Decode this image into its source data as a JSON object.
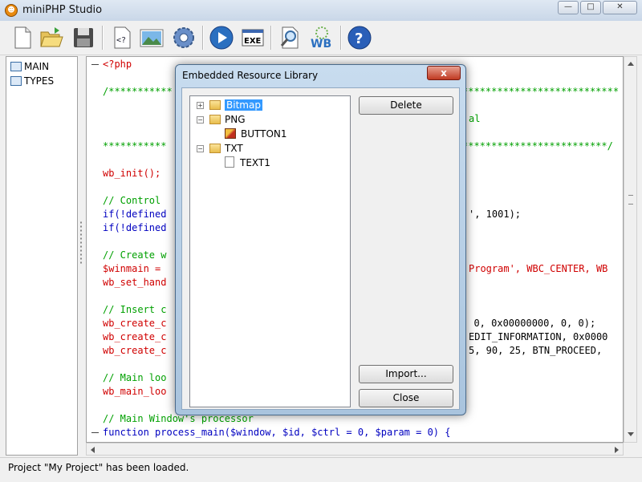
{
  "window": {
    "title": "miniPHP Studio",
    "minimize": "—",
    "maximize": "□",
    "close": "✕"
  },
  "toolbar": {
    "items": [
      {
        "name": "new-file-icon"
      },
      {
        "name": "open-folder-icon"
      },
      {
        "name": "save-icon"
      },
      {
        "name": "help-code-icon",
        "label": "<?"
      },
      {
        "name": "image-resource-icon"
      },
      {
        "name": "settings-gear-icon"
      },
      {
        "name": "run-play-icon"
      },
      {
        "name": "exe-build-icon",
        "label": "EXE"
      },
      {
        "name": "find-magnifier-icon"
      },
      {
        "name": "winbinder-icon",
        "label": "WB"
      },
      {
        "name": "help-question-icon",
        "label": "?"
      }
    ]
  },
  "left_tree": [
    {
      "label": "MAIN"
    },
    {
      "label": "TYPES"
    }
  ],
  "code": [
    {
      "text": "<?php",
      "color": "red",
      "fold": true
    },
    {
      "text": "",
      "color": "black"
    },
    {
      "text": "/***********",
      "color": "green",
      "right": "***************************"
    },
    {
      "text": "",
      "color": "black"
    },
    {
      "text": "",
      "color": "green",
      "right": "al"
    },
    {
      "text": "",
      "color": "black"
    },
    {
      "text": "***********",
      "color": "green",
      "right": "*************************/"
    },
    {
      "text": "",
      "color": "black"
    },
    {
      "text": "wb_init();",
      "color": "red"
    },
    {
      "text": "",
      "color": "black"
    },
    {
      "text": "// Control",
      "color": "green"
    },
    {
      "text": "if(!defined",
      "color": "blue",
      "right": "', 1001);"
    },
    {
      "text": "if(!defined",
      "color": "blue"
    },
    {
      "text": "",
      "color": "black"
    },
    {
      "text": "// Create w",
      "color": "green"
    },
    {
      "text": "$winmain =",
      "color": "red",
      "right": "Program', WBC_CENTER, WB"
    },
    {
      "text": "wb_set_hand",
      "color": "red"
    },
    {
      "text": "",
      "color": "black"
    },
    {
      "text": "// Insert c",
      "color": "green"
    },
    {
      "text": "wb_create_c",
      "color": "red",
      "right": ", 0, 0x00000000, 0, 0);"
    },
    {
      "text": "wb_create_c",
      "color": "red",
      "right": "EDIT_INFORMATION, 0x0000"
    },
    {
      "text": "wb_create_c",
      "color": "red",
      "right": "5, 90, 25, BTN_PROCEED,"
    },
    {
      "text": "",
      "color": "black"
    },
    {
      "text": "// Main loo",
      "color": "green"
    },
    {
      "text": "wb_main_loo",
      "color": "red"
    },
    {
      "text": "",
      "color": "black"
    },
    {
      "text": "// Main Window's processor",
      "color": "green"
    },
    {
      "text": "function process_main($window, $id, $ctrl = 0, $param = 0) {",
      "color": "blue",
      "fold": true
    }
  ],
  "status": {
    "text": "Project \"My Project\" has been loaded."
  },
  "dialog": {
    "title": "Embedded Resource Library",
    "close_label": "x",
    "tree": [
      {
        "label": "Bitmap",
        "level": 0,
        "expander": "+",
        "type": "folder",
        "selected": true
      },
      {
        "label": "PNG",
        "level": 0,
        "expander": "−",
        "type": "folder"
      },
      {
        "label": "BUTTON1",
        "level": 1,
        "type": "image"
      },
      {
        "label": "TXT",
        "level": 0,
        "expander": "−",
        "type": "folder"
      },
      {
        "label": "TEXT1",
        "level": 1,
        "type": "text"
      }
    ],
    "buttons": {
      "delete": "Delete",
      "import": "Import...",
      "close": "Close"
    }
  }
}
